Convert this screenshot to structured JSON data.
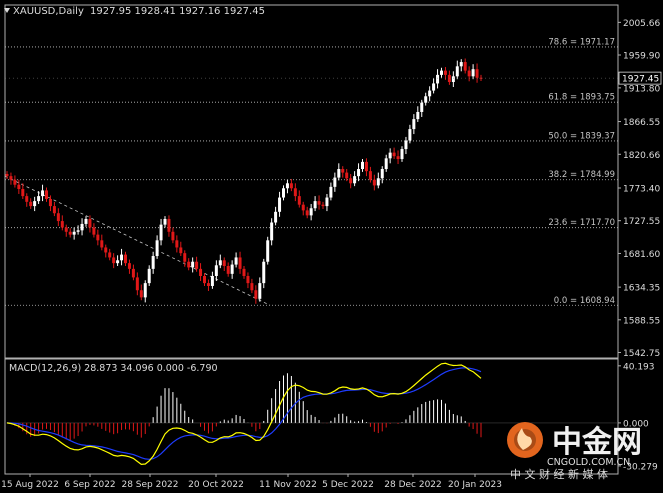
{
  "chart_data": {
    "type": "candlestick",
    "symbol_label": "XAUUSD,Daily",
    "ohlc_header": "1927.95 1928.41 1927.16 1927.45",
    "current_price_label": "1927.45",
    "current_price": 1927.45,
    "ylim": [
      1535,
      2030
    ],
    "price_ticks": [
      "2005.66",
      "1959.90",
      "1913.80",
      "1866.55",
      "1820.66",
      "1773.40",
      "1727.55",
      "1681.60",
      "1634.35",
      "1588.55",
      "1542.75"
    ],
    "x_ticks": [
      "15 Aug 2022",
      "6 Sep 2022",
      "28 Sep 2022",
      "20 Oct 2022",
      "11 Nov 2022",
      "5 Dec 2022",
      "28 Dec 2022",
      "20 Jan 2023"
    ],
    "fib_levels": [
      {
        "label": "78.6 = 1971.17",
        "value": 1971.17
      },
      {
        "label": "61.8 = 1893.75",
        "value": 1893.75
      },
      {
        "label": "50.0 = 1839.37",
        "value": 1839.37
      },
      {
        "label": "38.2 = 1784.99",
        "value": 1784.99
      },
      {
        "label": "23.6 = 1717.70",
        "value": 1717.7
      },
      {
        "label": "0.0 = 1608.94",
        "value": 1608.94
      }
    ],
    "closes": [
      1790,
      1785,
      1778,
      1772,
      1762,
      1754,
      1748,
      1755,
      1762,
      1770,
      1758,
      1748,
      1738,
      1727,
      1718,
      1712,
      1708,
      1712,
      1714,
      1723,
      1730,
      1718,
      1708,
      1700,
      1690,
      1683,
      1676,
      1668,
      1672,
      1680,
      1668,
      1660,
      1648,
      1630,
      1620,
      1640,
      1660,
      1678,
      1700,
      1722,
      1730,
      1712,
      1700,
      1690,
      1682,
      1670,
      1662,
      1670,
      1660,
      1650,
      1640,
      1636,
      1650,
      1665,
      1672,
      1664,
      1653,
      1666,
      1676,
      1660,
      1650,
      1640,
      1630,
      1618,
      1640,
      1670,
      1700,
      1725,
      1740,
      1760,
      1773,
      1780,
      1773,
      1762,
      1750,
      1742,
      1735,
      1745,
      1755,
      1750,
      1748,
      1760,
      1775,
      1788,
      1800,
      1795,
      1787,
      1780,
      1790,
      1800,
      1810,
      1797,
      1785,
      1777,
      1787,
      1800,
      1815,
      1823,
      1818,
      1814,
      1828,
      1840,
      1856,
      1870,
      1880,
      1893,
      1902,
      1910,
      1920,
      1932,
      1938,
      1932,
      1922,
      1930,
      1944,
      1950,
      1938,
      1930,
      1940,
      1928,
      1927.45
    ],
    "macd_label": "MACD(12,26,9) 28.873 34.096 0.000 -6.790",
    "macd_ticks": [
      "40.193",
      "0.000",
      "-30.279"
    ],
    "macd_ylim": [
      -36,
      45
    ]
  },
  "watermark": {
    "brand": "中金网",
    "site": "CNGOLD.COM.CN",
    "slogan": "中 文 财 经 新 媒 体"
  },
  "colors": {
    "up": "#ffffff",
    "down": "#e01818",
    "fib": "#c4c4c4",
    "macd_line": "#ffff00",
    "signal_line": "#1e3cff",
    "text": "#dcdcdc",
    "axis": "#b0b0b0",
    "logo": "#e2651e"
  }
}
